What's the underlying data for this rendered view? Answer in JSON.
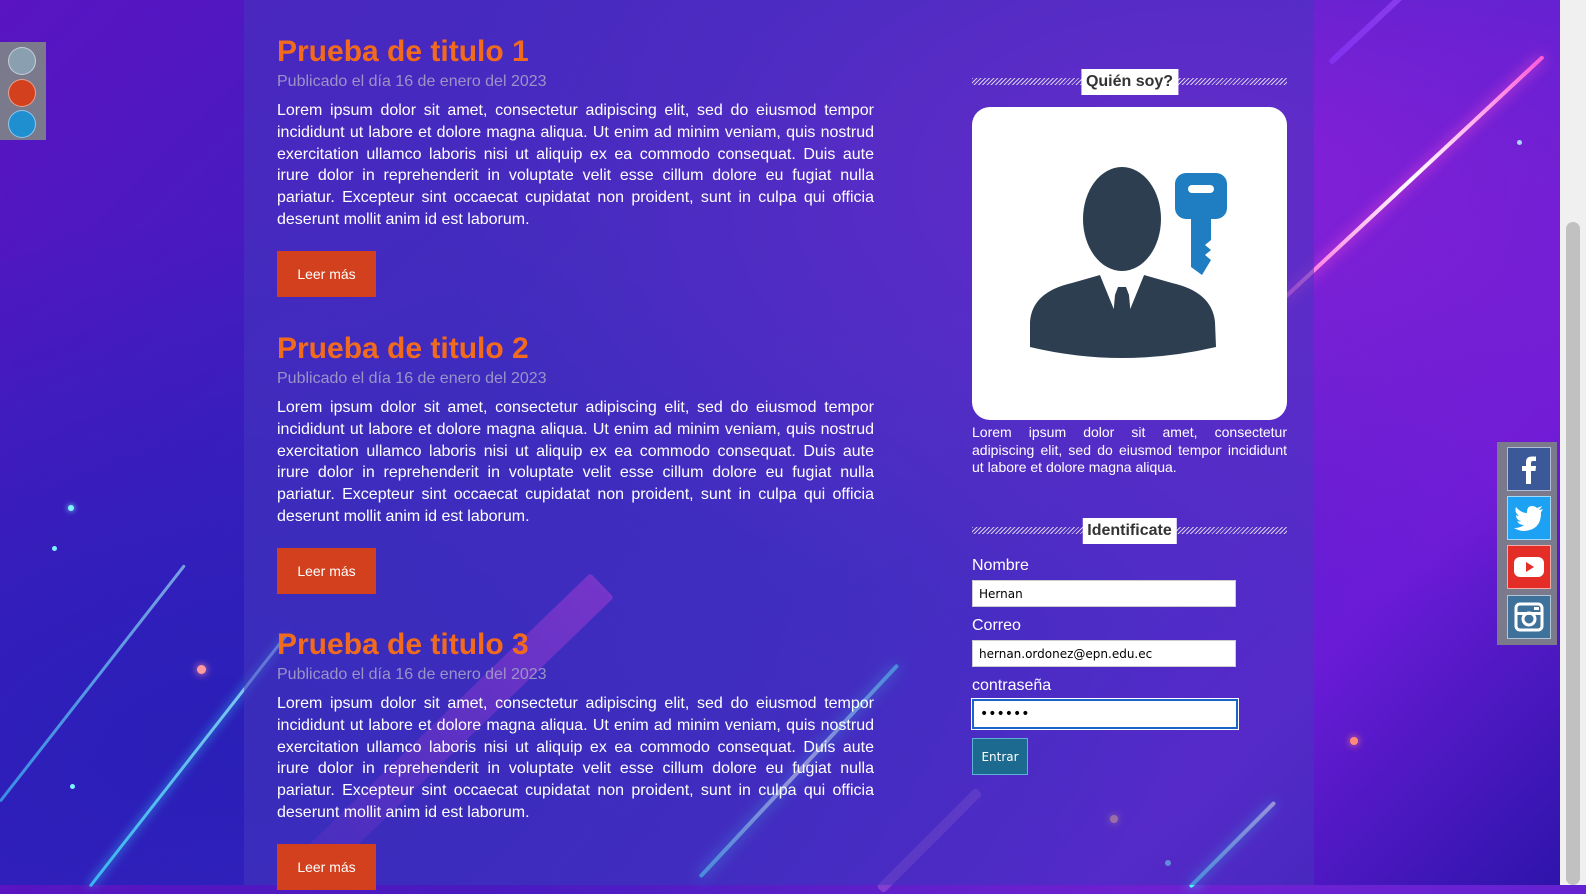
{
  "theme_swatches": [
    {
      "name": "gray",
      "color": "#8aa0b0"
    },
    {
      "name": "red",
      "color": "#d2401d"
    },
    {
      "name": "blue",
      "color": "#1f8fd0"
    }
  ],
  "posts": [
    {
      "title": "Prueba de titulo 1",
      "date": "Publicado el día 16 de enero del 2023",
      "body": "Lorem ipsum dolor sit amet, consectetur adipiscing elit, sed do eiusmod tempor incididunt ut labore et dolore magna aliqua. Ut enim ad minim veniam, quis nostrud exercitation ullamco laboris nisi ut aliquip ex ea commodo consequat. Duis aute irure dolor in reprehenderit in voluptate velit esse cillum dolore eu fugiat nulla pariatur. Excepteur sint occaecat cupidatat non proident, sunt in culpa qui officia deserunt mollit anim id est laborum.",
      "button": "Leer más"
    },
    {
      "title": "Prueba de titulo 2",
      "date": "Publicado el día 16 de enero del 2023",
      "body": "Lorem ipsum dolor sit amet, consectetur adipiscing elit, sed do eiusmod tempor incididunt ut labore et dolore magna aliqua. Ut enim ad minim veniam, quis nostrud exercitation ullamco laboris nisi ut aliquip ex ea commodo consequat. Duis aute irure dolor in reprehenderit in voluptate velit esse cillum dolore eu fugiat nulla pariatur. Excepteur sint occaecat cupidatat non proident, sunt in culpa qui officia deserunt mollit anim id est laborum.",
      "button": "Leer más"
    },
    {
      "title": "Prueba de titulo 3",
      "date": "Publicado el día 16 de enero del 2023",
      "body": "Lorem ipsum dolor sit amet, consectetur adipiscing elit, sed do eiusmod tempor incididunt ut labore et dolore magna aliqua. Ut enim ad minim veniam, quis nostrud exercitation ullamco laboris nisi ut aliquip ex ea commodo consequat. Duis aute irure dolor in reprehenderit in voluptate velit esse cillum dolore eu fugiat nulla pariatur. Excepteur sint occaecat cupidatat non proident, sunt in culpa qui officia deserunt mollit anim id est laborum.",
      "button": "Leer más"
    }
  ],
  "sidebar": {
    "about_title": "Quién soy?",
    "about_icon": "user-key-icon",
    "about_text": "Lorem ipsum dolor sit amet, consectetur adipiscing elit, sed do eiusmod tempor incididunt ut labore et dolore magna aliqua.",
    "login_title": "Identificate",
    "login": {
      "name_label": "Nombre",
      "name_value": "Hernan",
      "email_label": "Correo",
      "email_value": "hernan.ordonez@epn.edu.ec",
      "password_label": "contraseña",
      "password_value": "••••••",
      "submit": "Entrar"
    }
  },
  "social": [
    {
      "icon": "facebook-icon",
      "color": "#3b5998"
    },
    {
      "icon": "twitter-icon",
      "color": "#1da1f2"
    },
    {
      "icon": "youtube-icon",
      "color": "#e52d27"
    },
    {
      "icon": "instagram-icon",
      "color": "#3f729b"
    }
  ],
  "colors": {
    "title": "#f26b1d",
    "button": "#d2401d",
    "submit": "#1c6a8f"
  }
}
